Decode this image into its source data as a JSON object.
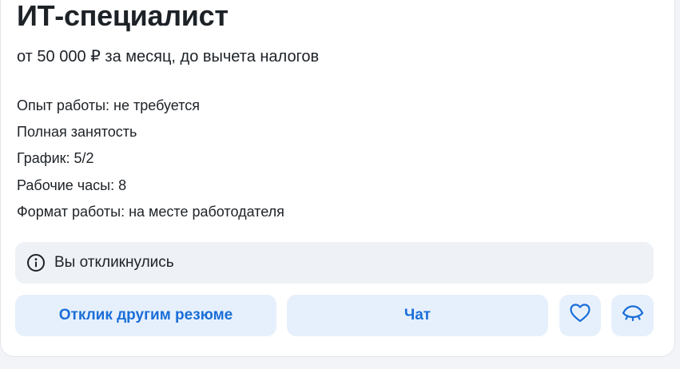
{
  "vacancy": {
    "title": "ИТ-специалист",
    "salary": "от 50 000 ₽ за месяц, до вычета налогов",
    "experience": "Опыт работы: не требуется",
    "employment": "Полная занятость",
    "schedule": "График: 5/2",
    "hours": "Рабочие часы: 8",
    "work_format": "Формат работы: на месте работодателя"
  },
  "notice": {
    "icon": "info-icon",
    "text": "Вы откликнулись"
  },
  "actions": {
    "respond_other_resume": "Отклик другим резюме",
    "chat": "Чат",
    "favorite_icon": "heart-icon",
    "hide_icon": "closed-eye-icon"
  },
  "colors": {
    "accent": "#1a6ed8",
    "button_bg": "#e6f0fc",
    "notice_bg": "#eef1f5",
    "text": "#1d2227"
  }
}
